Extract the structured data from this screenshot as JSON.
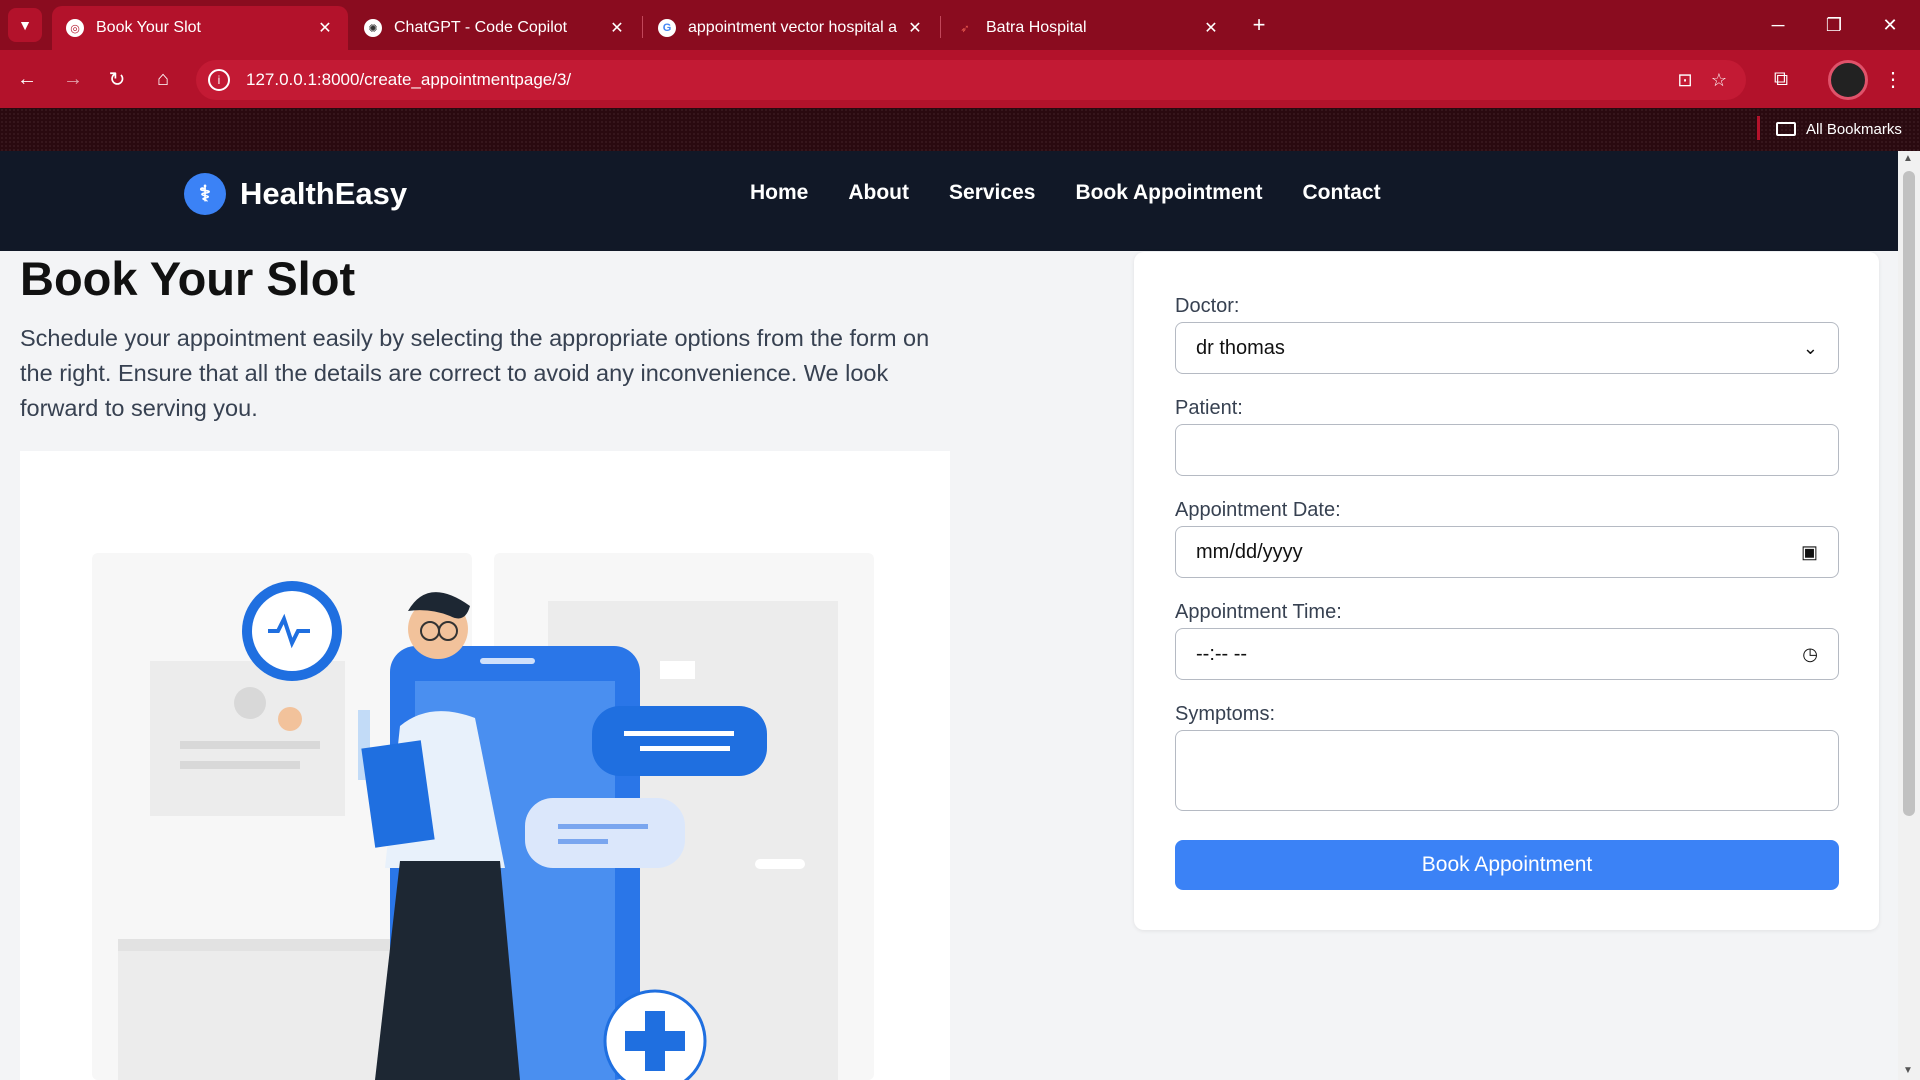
{
  "browser": {
    "tabs": [
      {
        "title": "Book Your Slot",
        "active": true
      },
      {
        "title": "ChatGPT - Code Copilot",
        "active": false
      },
      {
        "title": "appointment vector hospital ap",
        "active": false
      },
      {
        "title": "Batra Hospital",
        "active": false
      }
    ],
    "new_tab": "+",
    "url": "127.0.0.1:8000/create_appointmentpage/3/",
    "bookmarks_label": "All Bookmarks",
    "accent_color": "#b3122b"
  },
  "site": {
    "brand": "HealthEasy",
    "nav": [
      "Home",
      "About",
      "Services",
      "Book Appointment",
      "Contact"
    ]
  },
  "page": {
    "title": "Book Your Slot",
    "description": "Schedule your appointment easily by selecting the appropriate options from the form on the right. Ensure that all the details are correct to avoid any inconvenience. We look forward to serving you."
  },
  "form": {
    "doctor_label": "Doctor:",
    "doctor_value": "dr thomas",
    "patient_label": "Patient:",
    "patient_value": "",
    "date_label": "Appointment Date:",
    "date_value": "mm/dd/yyyy",
    "time_label": "Appointment Time:",
    "time_value": "--:-- --",
    "symptoms_label": "Symptoms:",
    "symptoms_value": "",
    "submit_label": "Book Appointment",
    "submit_color": "#3b82f6"
  }
}
